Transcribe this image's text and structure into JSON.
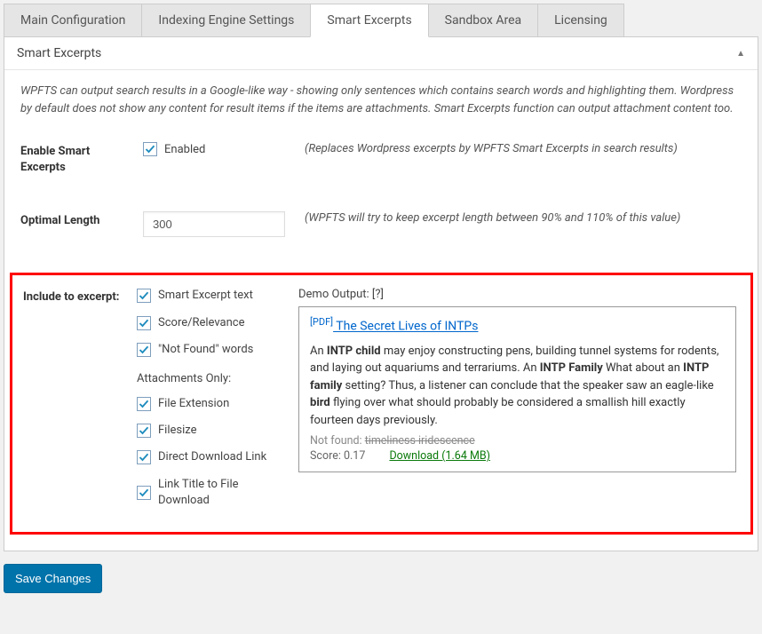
{
  "tabs": {
    "main": "Main Configuration",
    "indexing": "Indexing Engine Settings",
    "smart": "Smart Excerpts",
    "sandbox": "Sandbox Area",
    "licensing": "Licensing"
  },
  "panel": {
    "title": "Smart Excerpts",
    "intro": "WPFTS can output search results in a Google-like way - showing only sentences which contains search words and highlighting them. Wordpress by default does not show any content for result items if the items are attachments. Smart Excerpts function can output attachment content too."
  },
  "enableRow": {
    "label": "Enable Smart Excerpts",
    "checkbox_label": "Enabled",
    "hint": "(Replaces Wordpress excerpts by WPFTS Smart Excerpts in search results)"
  },
  "lengthRow": {
    "label": "Optimal Length",
    "value": "300",
    "hint": "(WPFTS will try to keep excerpt length between 90% and 110% of this value)"
  },
  "includeRow": {
    "label": "Include to excerpt:",
    "opts": {
      "smart": "Smart Excerpt text",
      "score": "Score/Relevance",
      "notfound": "\"Not Found\" words"
    },
    "subheading": "Attachments Only:",
    "att_opts": {
      "ext": "File Extension",
      "filesize": "Filesize",
      "direct": "Direct Download Link",
      "linktitle": "Link Title to File Download"
    }
  },
  "demo": {
    "title": "Demo Output: [?]",
    "pdf_tag": "[PDF]",
    "result_title": " The Secret Lives of INTPs",
    "body_pre1": "An ",
    "body_b1": "INTP child",
    "body_mid1": " may enjoy constructing pens, building tunnel systems for rodents, and laying out aquariums and terrariums. An ",
    "body_b2": "INTP Family",
    "body_mid2": " What about an ",
    "body_b3": "INTP family",
    "body_mid3": " setting? Thus, a listener can conclude that the speaker saw an eagle-like ",
    "body_b4": "bird",
    "body_post": " flying over what should probably be considered a smallish hill exactly fourteen days previously.",
    "notfound_label": "Not found: ",
    "notfound_words": "timeliness iridescence",
    "score_label": "Score: 0.17",
    "download_label": "Download (1.64 MB)"
  },
  "save_label": "Save Changes"
}
